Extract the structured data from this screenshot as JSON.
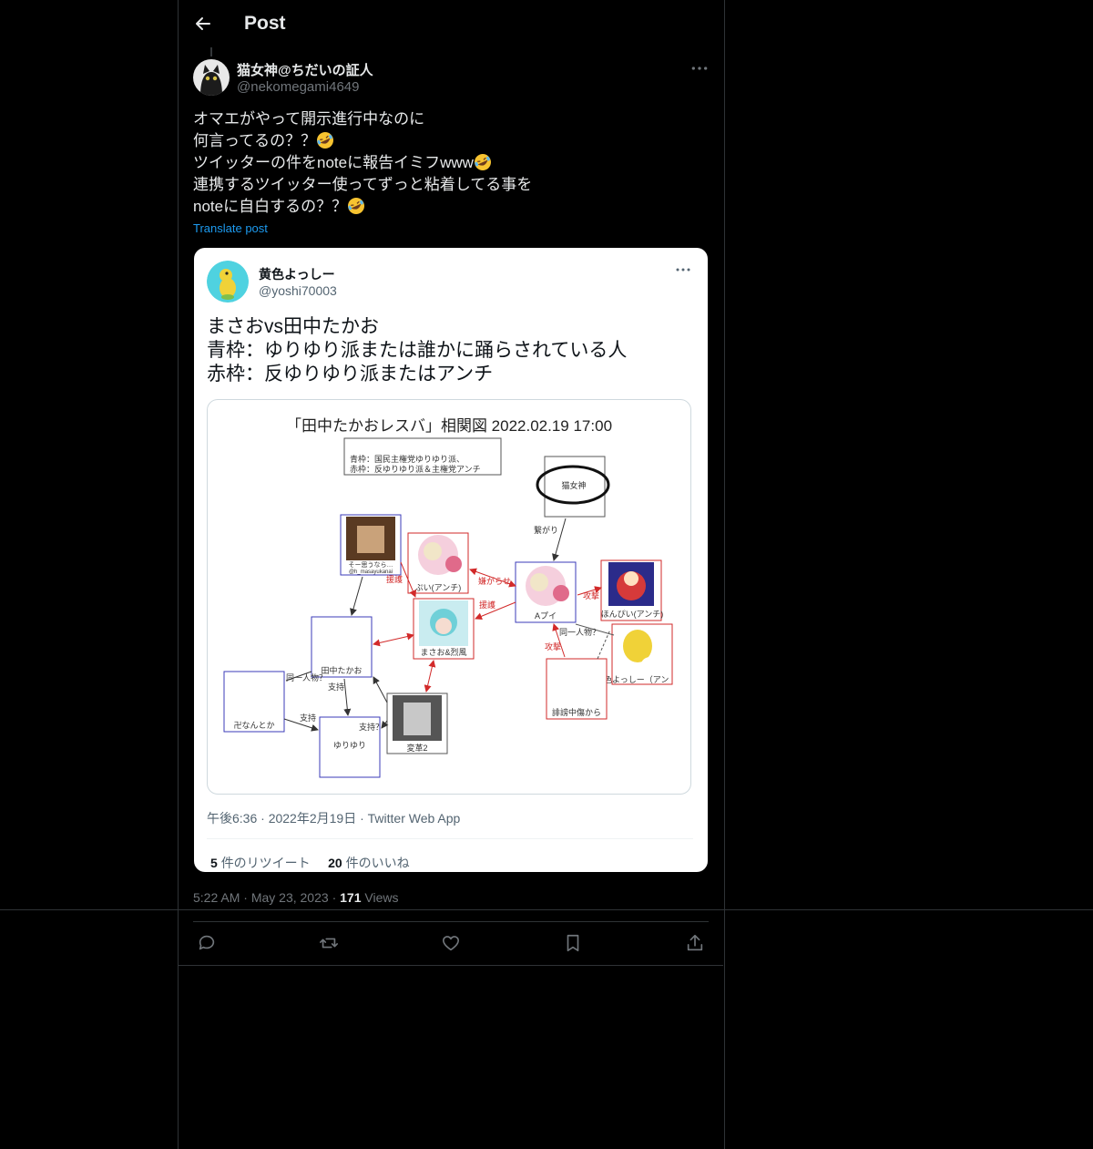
{
  "header": {
    "title": "Post",
    "back_icon": "arrow-left-icon"
  },
  "post": {
    "author_name": "猫女神@ちだいの証人",
    "author_handle": "@nekomegami4649",
    "text_lines": [
      "オマエがやって開示進行中なのに",
      "何言ってるの？？",
      "ツイッターの件をnoteに報告イミフwww",
      "連携するツイッター使ってずっと粘着してる事を",
      "noteに自白するの？？"
    ],
    "emoji": "rolling-on-floor-laughing",
    "translate_label": "Translate post",
    "time": "5:22 AM",
    "date": "May 23, 2023",
    "views_count": "171",
    "views_label": "Views",
    "separator": "·"
  },
  "quote": {
    "author_name": "黄色よっしー",
    "author_handle": "@yoshi70003",
    "text_lines": [
      "まさおvs田中たかお",
      "青枠：ゆりゆり派または誰かに踊らされている人",
      "赤枠：反ゆりゆり派またはアンチ"
    ],
    "figure": {
      "title": "「田中たかおレスバ」相関図 2022.02.19 17:00",
      "legend_line1": "青枠：国民主権党ゆりゆり派、",
      "legend_line2": "赤枠：反ゆりゆり派＆主権党アンチ",
      "nodes": {
        "nekomegami": "猫女神",
        "somebody": "そー思うなら…",
        "somebody_handle": "@h_masayukanai",
        "pui": "ぷい(アンチ)",
        "a_pui": "Aプイ",
        "honbi": "ほんぴい(アンチ)",
        "masao": "まさお&烈風",
        "tanaka": "田中たかお",
        "manji": "卍なんとか",
        "yuriyuri": "ゆりゆり",
        "kakumei": "変革2",
        "yoshi": "黄色よっしー（アン",
        "hibou": "誹謗中傷から"
      },
      "edges": {
        "connected": "繋がり",
        "support1": "援護",
        "support2": "援護",
        "hated": "嫌がらせ",
        "attack1": "攻撃",
        "attack2": "攻撃",
        "same_person1": "同一人物？",
        "same_person2": "同一人物？",
        "backing1": "支持",
        "backing2": "支持",
        "backing3": "支持？"
      }
    },
    "meta": "午後6:36 · 2022年2月19日 · Twitter Web App",
    "retweets_count": "5",
    "retweets_label": "件のリツイート",
    "likes_count": "20",
    "likes_label": "件のいいね"
  },
  "actions": [
    {
      "name": "reply",
      "icon": "reply-icon"
    },
    {
      "name": "repost",
      "icon": "repost-icon"
    },
    {
      "name": "like",
      "icon": "heart-icon"
    },
    {
      "name": "bookmark",
      "icon": "bookmark-icon"
    },
    {
      "name": "share",
      "icon": "share-icon"
    }
  ],
  "colors": {
    "background": "#000000",
    "text": "#e7e9ea",
    "muted": "#71767b",
    "link": "#1d9bf0",
    "border": "#2f3336",
    "figure_blue": "#3b3bb8",
    "figure_red": "#d22a2a"
  }
}
